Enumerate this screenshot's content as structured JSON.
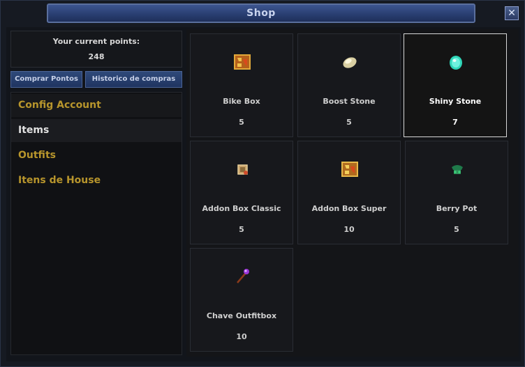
{
  "window": {
    "title": "Shop",
    "close_glyph": "✕"
  },
  "points": {
    "label": "Your current points:",
    "value": "248"
  },
  "buttons": {
    "buy_points": "Comprar Pontos",
    "history": "Historico de compras"
  },
  "categories": [
    {
      "label": "Config Account",
      "state": "header"
    },
    {
      "label": "Items",
      "state": "selected"
    },
    {
      "label": "Outfits",
      "state": "normal"
    },
    {
      "label": "Itens de House",
      "state": "normal"
    }
  ],
  "items": [
    {
      "name": "Bike Box",
      "price": "5",
      "icon": "bike-box-icon"
    },
    {
      "name": "Boost Stone",
      "price": "5",
      "icon": "boost-stone-icon"
    },
    {
      "name": "Shiny Stone",
      "price": "7",
      "icon": "shiny-stone-icon",
      "selected": true
    },
    {
      "name": "Addon Box Classic",
      "price": "5",
      "icon": "addon-box-classic-icon"
    },
    {
      "name": "Addon Box Super",
      "price": "10",
      "icon": "addon-box-super-icon"
    },
    {
      "name": "Berry Pot",
      "price": "5",
      "icon": "berry-pot-icon"
    },
    {
      "name": "Chave Outfitbox",
      "price": "10",
      "icon": "outfit-key-icon"
    }
  ],
  "colors": {
    "gold_category": "#b7952c",
    "title_bar": "#2a3f72",
    "selected_border": "#d8d8d8"
  }
}
